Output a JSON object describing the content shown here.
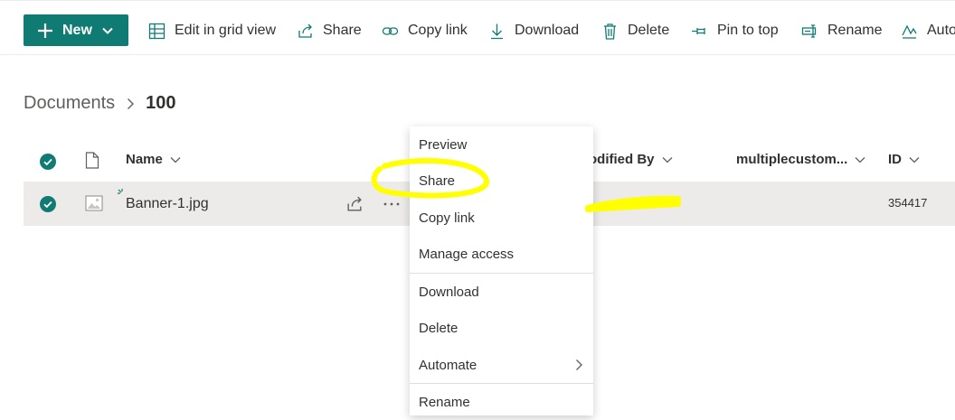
{
  "toolbar": {
    "new_label": "New",
    "commands": [
      {
        "label": "Edit in grid view",
        "icon": "grid-icon"
      },
      {
        "label": "Share",
        "icon": "share-icon"
      },
      {
        "label": "Copy link",
        "icon": "link-icon"
      },
      {
        "label": "Download",
        "icon": "download-icon"
      },
      {
        "label": "Delete",
        "icon": "trash-icon"
      },
      {
        "label": "Pin to top",
        "icon": "pin-icon"
      },
      {
        "label": "Rename",
        "icon": "rename-icon"
      },
      {
        "label": "Auto",
        "icon": "automate-icon"
      }
    ]
  },
  "breadcrumb": {
    "root": "Documents",
    "current": "100"
  },
  "list": {
    "columns": {
      "name": "Name",
      "modified_by": "odified By",
      "custom": "multiplecustom...",
      "id": "ID"
    },
    "rows": [
      {
        "name": "Banner-1.jpg",
        "id": "354417",
        "selected": true
      }
    ]
  },
  "context_menu": {
    "items": [
      "Preview",
      "Share",
      "Copy link",
      "Manage access",
      "Download",
      "Delete",
      "Automate",
      "Rename"
    ]
  },
  "colors": {
    "accent": "#0f7b73",
    "highlight": "#ffff00",
    "row_selected": "#edebe9"
  }
}
